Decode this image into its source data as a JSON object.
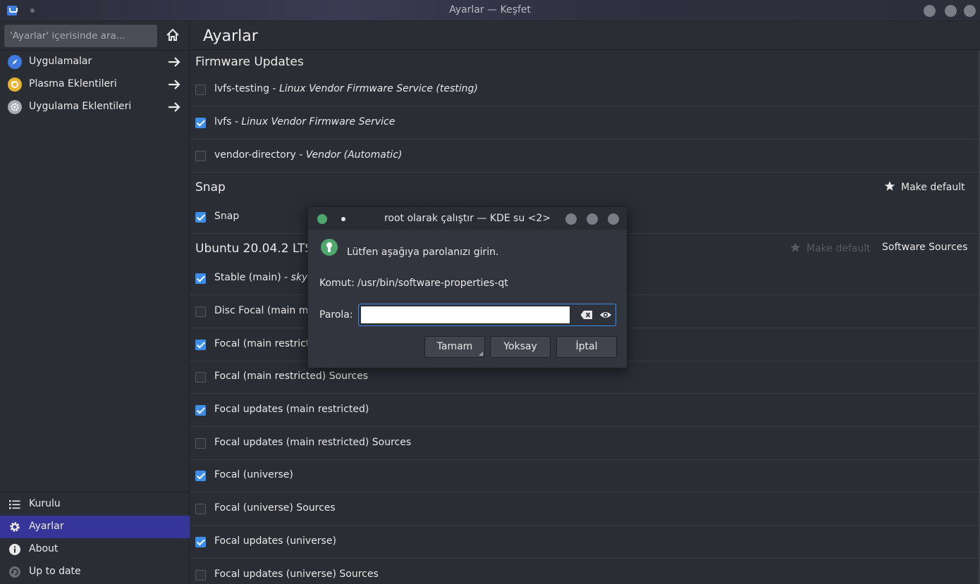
{
  "window": {
    "title": "Ayarlar — Keşfet"
  },
  "sidebar": {
    "search_placeholder": "'Ayarlar' içerisinde ara...",
    "top_items": [
      {
        "label": "Uygulamalar",
        "icon": "compass-icon",
        "color": "#3d7be0"
      },
      {
        "label": "Plasma Eklentileri",
        "icon": "plasma-icon",
        "color": "#e8b430"
      },
      {
        "label": "Uygulama Eklentileri",
        "icon": "gear-icon",
        "color": "#a8aab2"
      }
    ],
    "bottom_items": [
      {
        "label": "Kurulu",
        "icon": "list-icon"
      },
      {
        "label": "Ayarlar",
        "icon": "settings-icon",
        "active": true
      },
      {
        "label": "About",
        "icon": "info-icon"
      },
      {
        "label": "Up to date",
        "icon": "update-icon"
      }
    ]
  },
  "main": {
    "title": "Ayarlar",
    "sections": [
      {
        "heading": "Firmware Updates",
        "rows": [
          {
            "name": "lvfs-testing",
            "desc": "Linux Vendor Firmware Service (testing)",
            "checked": false
          },
          {
            "name": "lvfs",
            "desc": "Linux Vendor Firmware Service",
            "checked": true
          },
          {
            "name": "vendor-directory",
            "desc": "Vendor (Automatic)",
            "checked": false
          }
        ]
      },
      {
        "heading": "Snap",
        "make_default": "Make default",
        "rows": [
          {
            "name": "Snap",
            "checked": true
          }
        ]
      },
      {
        "heading": "Ubuntu 20.04.2 LTS",
        "make_default": "Make default",
        "software_sources": "Software Sources",
        "rows": [
          {
            "name": "Stable (main)",
            "desc": "skype",
            "checked": true
          },
          {
            "name": "Disc Focal (main mul",
            "checked": false
          },
          {
            "name": "Focal (main restricte",
            "checked": true
          },
          {
            "name": "Focal (main restricted) Sources",
            "checked": false
          },
          {
            "name": "Focal updates (main restricted)",
            "checked": true
          },
          {
            "name": "Focal updates (main restricted) Sources",
            "checked": false
          },
          {
            "name": "Focal (universe)",
            "checked": true
          },
          {
            "name": "Focal (universe) Sources",
            "checked": false
          },
          {
            "name": "Focal updates (universe)",
            "checked": true
          },
          {
            "name": "Focal updates (universe) Sources",
            "checked": false
          }
        ]
      }
    ]
  },
  "dialog": {
    "title": "root olarak çalıştır — KDE su <2>",
    "message": "Lütfen aşağıya parolanızı girin.",
    "command_label": "Komut:",
    "command_value": "/usr/bin/software-properties-qt",
    "password_label": "Parola:",
    "password_value": "",
    "buttons": {
      "ok": "Tamam",
      "ignore": "Yoksay",
      "cancel": "İptal"
    }
  },
  "colors": {
    "accent": "#3d8ee8",
    "active_nav": "#35359a",
    "lock_green": "#4ea86e"
  }
}
